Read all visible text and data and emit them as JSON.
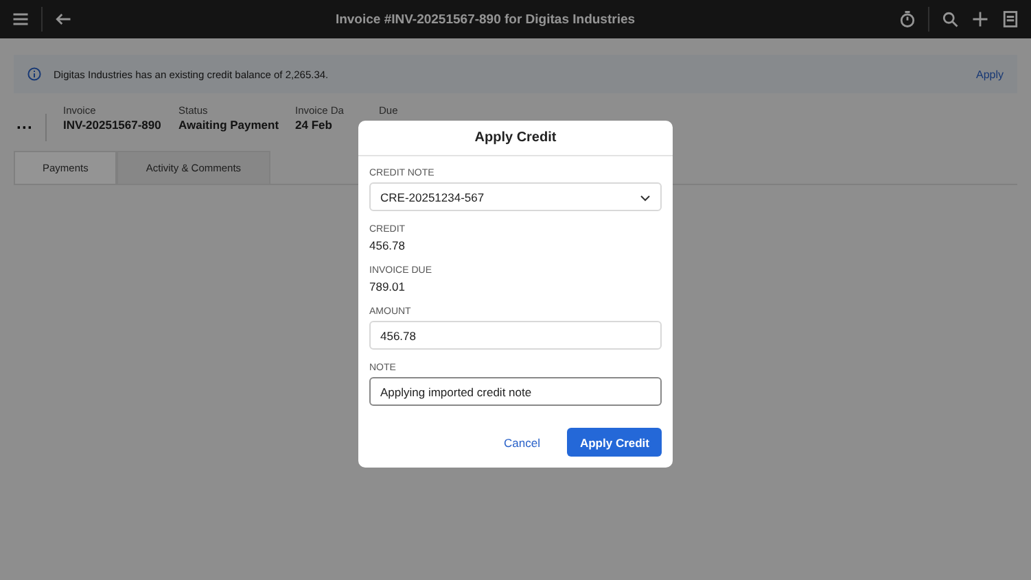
{
  "top_bar": {
    "title": "Invoice #INV-20251567-890 for Digitas Industries"
  },
  "banner": {
    "message": "Digitas Industries has an existing credit balance of 2,265.34.",
    "action": "Apply"
  },
  "summary": {
    "more": "···",
    "fields": [
      {
        "label": "Invoice",
        "value": "INV-20251567-890"
      },
      {
        "label": "Status",
        "value": "Awaiting Payment"
      },
      {
        "label": "Invoice Da",
        "value": "24 Feb"
      },
      {
        "label": "Due"
      }
    ]
  },
  "tabs": [
    {
      "label": "Payments",
      "selected": true
    },
    {
      "label": "Activity & Comments",
      "selected": false
    }
  ],
  "dialog": {
    "title": "Apply Credit",
    "credit_note": {
      "label": "CREDIT NOTE",
      "value": "CRE-20251234-567"
    },
    "credit": {
      "label": "CREDIT",
      "value": "456.78"
    },
    "invoice_due": {
      "label": "INVOICE DUE",
      "value": "789.01"
    },
    "amount": {
      "label": "AMOUNT",
      "value": "456.78"
    },
    "note": {
      "label": "NOTE",
      "value": "Applying imported credit note"
    },
    "cancel": "Cancel",
    "submit": "Apply Credit"
  }
}
